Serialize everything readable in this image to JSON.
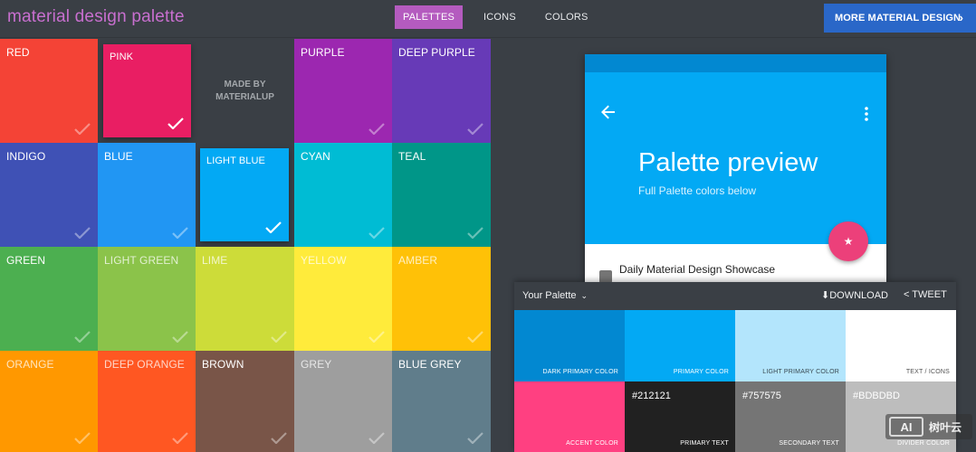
{
  "header": {
    "brand": "material design palette",
    "nav": [
      {
        "label": "PALETTES",
        "active": true
      },
      {
        "label": "ICONS",
        "active": false
      },
      {
        "label": "COLORS",
        "active": false
      }
    ],
    "cta": "MORE MATERIAL DESIGN",
    "cta_icon": "chevron-right-icon"
  },
  "grid": {
    "made_by": [
      "MADE BY",
      "MATERIALUP"
    ],
    "tiles": [
      {
        "name": "RED",
        "color": "#f44336"
      },
      {
        "name": "PINK",
        "color": "#e91e63",
        "selected": true
      },
      {
        "name": "PURPLE",
        "color": "#9c27b0"
      },
      {
        "name": "DEEP PURPLE",
        "color": "#673ab7"
      },
      {
        "name": "INDIGO",
        "color": "#3f51b5"
      },
      {
        "name": "BLUE",
        "color": "#2196f3"
      },
      {
        "name": "LIGHT BLUE",
        "color": "#03a9f4",
        "selected": true
      },
      {
        "name": "CYAN",
        "color": "#00bcd4"
      },
      {
        "name": "TEAL",
        "color": "#009688"
      },
      {
        "name": "GREEN",
        "color": "#4caf50"
      },
      {
        "name": "LIGHT GREEN",
        "color": "#8bc34a"
      },
      {
        "name": "LIME",
        "color": "#cddc39"
      },
      {
        "name": "YELLOW",
        "color": "#ffeb3b"
      },
      {
        "name": "AMBER",
        "color": "#ffc107"
      },
      {
        "name": "ORANGE",
        "color": "#ff9800"
      },
      {
        "name": "DEEP ORANGE",
        "color": "#ff5722"
      },
      {
        "name": "BROWN",
        "color": "#795548"
      },
      {
        "name": "GREY",
        "color": "#9e9e9e"
      },
      {
        "name": "BLUE GREY",
        "color": "#607d8b"
      }
    ]
  },
  "preview": {
    "title": "Palette preview",
    "subtitle": "Full Palette colors below",
    "list_item": "Daily Material Design Showcase",
    "status_color": "#0288d1",
    "appbar_color": "#03a9f4",
    "fab_color": "#ec407a"
  },
  "your_palette": {
    "title": "Your Palette",
    "download": "DOWNLOAD",
    "tweet": "TWEET",
    "swatches": [
      {
        "label": "DARK PRIMARY COLOR",
        "color": "#0288d1"
      },
      {
        "label": "PRIMARY COLOR",
        "color": "#03a9f4"
      },
      {
        "label": "LIGHT PRIMARY COLOR",
        "color": "#b3e5fc",
        "light": true
      },
      {
        "label": "TEXT / ICONS",
        "color": "#ffffff",
        "light": true
      },
      {
        "label": "ACCENT COLOR",
        "color": "#ff4081"
      },
      {
        "label": "PRIMARY TEXT",
        "hex": "#212121",
        "color": "#212121"
      },
      {
        "label": "SECONDARY TEXT",
        "hex": "#757575",
        "color": "#757575"
      },
      {
        "label": "DIVIDER COLOR",
        "hex": "#BDBDBD",
        "color": "#bdbdbd"
      }
    ]
  },
  "watermark": {
    "badge": "AI",
    "text": "树叶云"
  }
}
